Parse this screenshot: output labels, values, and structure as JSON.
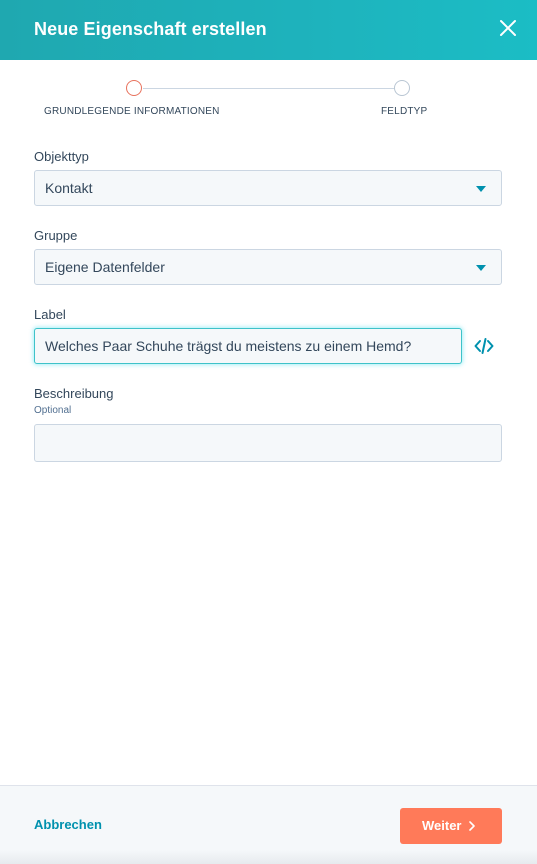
{
  "header": {
    "title": "Neue Eigenschaft erstellen",
    "close_icon": "close-icon"
  },
  "stepper": {
    "steps": [
      {
        "label": "GRUNDLEGENDE INFORMATIONEN",
        "state": "active"
      },
      {
        "label": "FELDTYP",
        "state": "inactive"
      }
    ]
  },
  "form": {
    "object_type": {
      "label": "Objekttyp",
      "value": "Kontakt"
    },
    "group": {
      "label": "Gruppe",
      "value": "Eigene Datenfelder"
    },
    "label_field": {
      "label": "Label",
      "value": "Welches Paar Schuhe trägst du meistens zu einem Hemd?",
      "code_icon": "code-icon"
    },
    "description": {
      "label": "Beschreibung",
      "sub": "Optional",
      "value": ""
    }
  },
  "footer": {
    "cancel_label": "Abbrechen",
    "next_label": "Weiter"
  },
  "colors": {
    "header_bg": "#1eb3bd",
    "accent_link": "#0091ae",
    "primary_button": "#ff7a59",
    "active_step": "#e8735e"
  }
}
